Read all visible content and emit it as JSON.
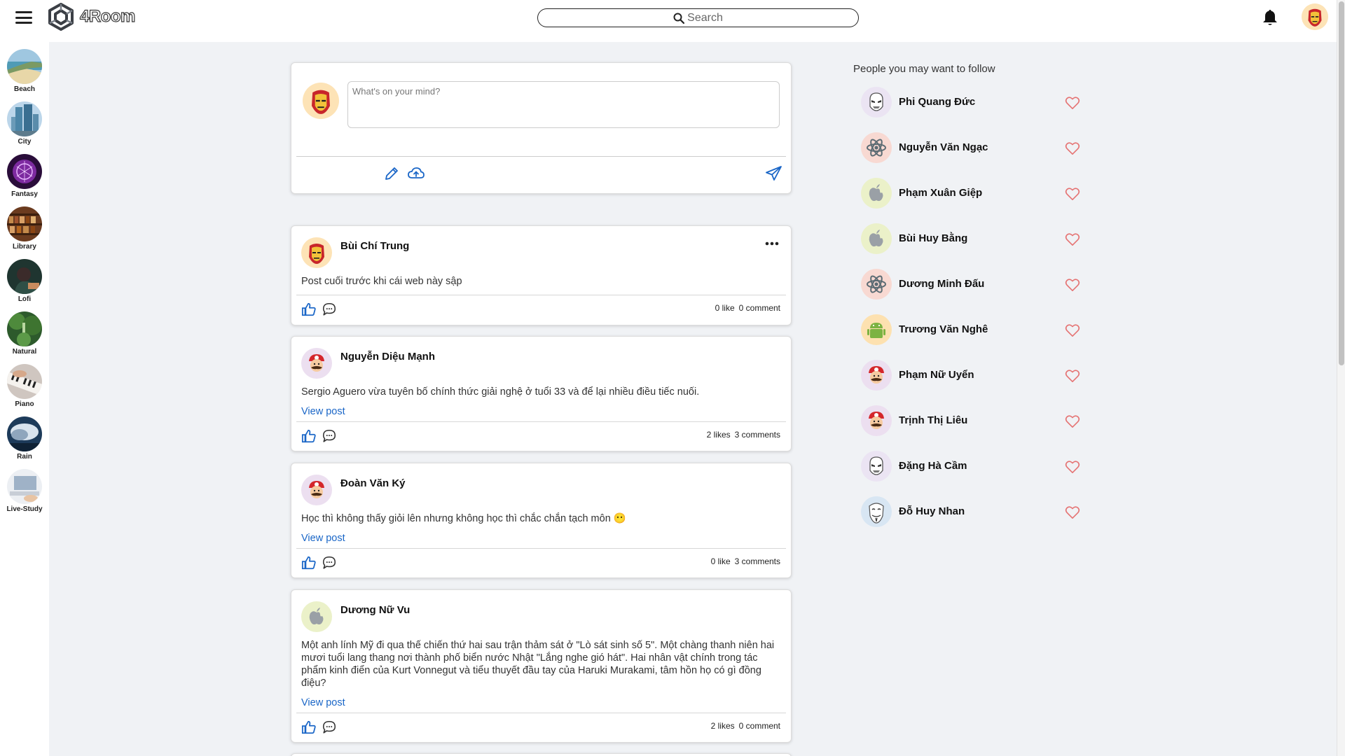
{
  "header": {
    "app_name": "4Room",
    "search_placeholder": "Search"
  },
  "rooms": [
    {
      "label": "Beach"
    },
    {
      "label": "City"
    },
    {
      "label": "Fantasy"
    },
    {
      "label": "Library"
    },
    {
      "label": "Lofi"
    },
    {
      "label": "Natural"
    },
    {
      "label": "Piano"
    },
    {
      "label": "Rain"
    },
    {
      "label": "Live-Study"
    }
  ],
  "composer": {
    "placeholder": "What's on your mind?"
  },
  "posts": [
    {
      "author": "Bùi Chí Trung",
      "avatar": "iron-man",
      "content": "Post cuối trước khi cái web này sập",
      "likes": "0 like",
      "comments": "0 comment"
    },
    {
      "author": "Nguyễn Diệu Mạnh",
      "avatar": "mario",
      "content": "Sergio Aguero vừa tuyên bố chính thức giải nghệ ở tuổi 33 và để lại nhiều điều tiếc nuối.",
      "view_post": "View post",
      "likes": "2 likes",
      "comments": "3 comments"
    },
    {
      "author": "Đoàn Văn Ký",
      "avatar": "mario",
      "content": "Học thì không thấy giỏi lên nhưng không học thì chắc chắn tạch môn 😶",
      "view_post": "View post",
      "likes": "0 like",
      "comments": "3 comments"
    },
    {
      "author": "Dương Nữ Vu",
      "avatar": "apple",
      "content": "Một anh lính Mỹ đi qua thế chiến thứ hai sau trận thảm sát ở \"Lò sát sinh số 5\". Một chàng thanh niên hai mươi tuổi lang thang nơi thành phố biển nước Nhật \"Lắng nghe gió hát\". Hai nhân vật chính trong tác phẩm kinh điển của Kurt Vonnegut và tiểu thuyết đầu tay của Haruki Murakami, tâm hồn họ có gì đồng điệu?",
      "view_post": "View post",
      "likes": "2 likes",
      "comments": "0 comment"
    }
  ],
  "suggestions": {
    "title": "People you may want to follow",
    "people": [
      {
        "name": "Phi Quang Đức",
        "avatar": "stormtrooper"
      },
      {
        "name": "Nguyễn Văn Ngạc",
        "avatar": "react"
      },
      {
        "name": "Phạm Xuân Giệp",
        "avatar": "apple"
      },
      {
        "name": "Bùi Huy Bằng",
        "avatar": "apple"
      },
      {
        "name": "Dương Minh Đấu",
        "avatar": "react"
      },
      {
        "name": "Trương Văn Nghê",
        "avatar": "android"
      },
      {
        "name": "Phạm Nữ Uyển",
        "avatar": "mario"
      },
      {
        "name": "Trịnh Thị Liêu",
        "avatar": "mario"
      },
      {
        "name": "Đặng Hà Cầm",
        "avatar": "stormtrooper"
      },
      {
        "name": "Đỗ Huy Nhan",
        "avatar": "anonymous-mask"
      }
    ]
  },
  "colors": {
    "accent": "#1a66c7",
    "heart": "#e57373",
    "background": "#f0f2f5"
  }
}
